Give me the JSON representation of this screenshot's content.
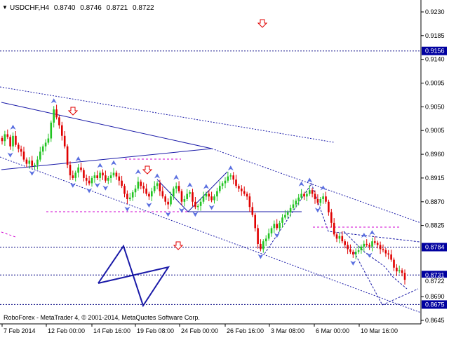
{
  "header": {
    "arrow_glyph": "▼",
    "symbol": "USDCHF,H4",
    "open": "0.8740",
    "high": "0.8746",
    "low": "0.8721",
    "close": "0.8722"
  },
  "footer": {
    "copyright": "RoboForex - MetaTrader 4, © 2001-2014, MetaQuotes Software Corp."
  },
  "colors": {
    "bull": "#22c422",
    "bear": "#e00000",
    "line": "#1a1aa8",
    "level": "#000080",
    "pink": "#d000d0",
    "fractal": "#5a6fe0",
    "hl_bg": "#0000a0",
    "hl_fg": "#ffffff"
  },
  "chart_data": {
    "type": "candlestick",
    "symbol": "USDCHF,H4",
    "ylim": [
      0.8645,
      0.925
    ],
    "y_ticks": [
      "0.9230",
      "0.9185",
      "0.9140",
      "0.9095",
      "0.9050",
      "0.9005",
      "0.8960",
      "0.8915",
      "0.8870",
      "0.8825",
      "0.8690",
      "0.8645"
    ],
    "highlighted_prices": [
      "0.9156",
      "0.8784",
      "0.8731",
      "0.8675"
    ],
    "current_price": "0.8722",
    "x_labels": [
      "7 Feb 2014",
      "12 Feb 00:00",
      "14 Feb 16:00",
      "19 Feb 08:00",
      "24 Feb 00:00",
      "26 Feb 16:00",
      "3 Mar 08:00",
      "6 Mar 00:00",
      "10 Mar 16:00"
    ],
    "horizontal_levels": [
      0.9156,
      0.8784,
      0.8731,
      0.8675
    ],
    "close_series": [
      0.8985,
      0.8998,
      0.8993,
      0.8975,
      0.8995,
      0.8978,
      0.897,
      0.8965,
      0.895,
      0.8942,
      0.8948,
      0.8938,
      0.894,
      0.895,
      0.8965,
      0.8975,
      0.8982,
      0.899,
      0.902,
      0.9045,
      0.903,
      0.9015,
      0.8995,
      0.8975,
      0.894,
      0.892,
      0.8915,
      0.8925,
      0.8935,
      0.893,
      0.8915,
      0.891,
      0.8905,
      0.8915,
      0.892,
      0.8915,
      0.8925,
      0.892,
      0.891,
      0.8915,
      0.892,
      0.8925,
      0.8918,
      0.891,
      0.89,
      0.8885,
      0.8875,
      0.8878,
      0.8888,
      0.8895,
      0.8908,
      0.89,
      0.8895,
      0.8885,
      0.888,
      0.889,
      0.89,
      0.8905,
      0.889,
      0.888,
      0.887,
      0.8865,
      0.888,
      0.8895,
      0.89,
      0.889,
      0.887,
      0.8875,
      0.8885,
      0.8888,
      0.887,
      0.886,
      0.8862,
      0.887,
      0.888,
      0.8885,
      0.888,
      0.8873,
      0.888,
      0.889,
      0.89,
      0.8905,
      0.891,
      0.8918,
      0.892,
      0.8912,
      0.89,
      0.8895,
      0.889,
      0.8885,
      0.888,
      0.886,
      0.8845,
      0.882,
      0.879,
      0.878,
      0.8795,
      0.88,
      0.881,
      0.882,
      0.8828,
      0.882,
      0.883,
      0.884,
      0.8845,
      0.885,
      0.8858,
      0.8865,
      0.8872,
      0.8878,
      0.8885,
      0.888,
      0.8885,
      0.8892,
      0.8885,
      0.8875,
      0.8868,
      0.8875,
      0.888,
      0.887,
      0.885,
      0.883,
      0.8808,
      0.88,
      0.8805,
      0.8795,
      0.8788,
      0.878,
      0.8775,
      0.877,
      0.8775,
      0.8778,
      0.8785,
      0.879,
      0.8788,
      0.8785,
      0.8795,
      0.8792,
      0.8788,
      0.878,
      0.8778,
      0.8772,
      0.877,
      0.876,
      0.8745,
      0.8738,
      0.874,
      0.8735,
      0.8722
    ]
  }
}
